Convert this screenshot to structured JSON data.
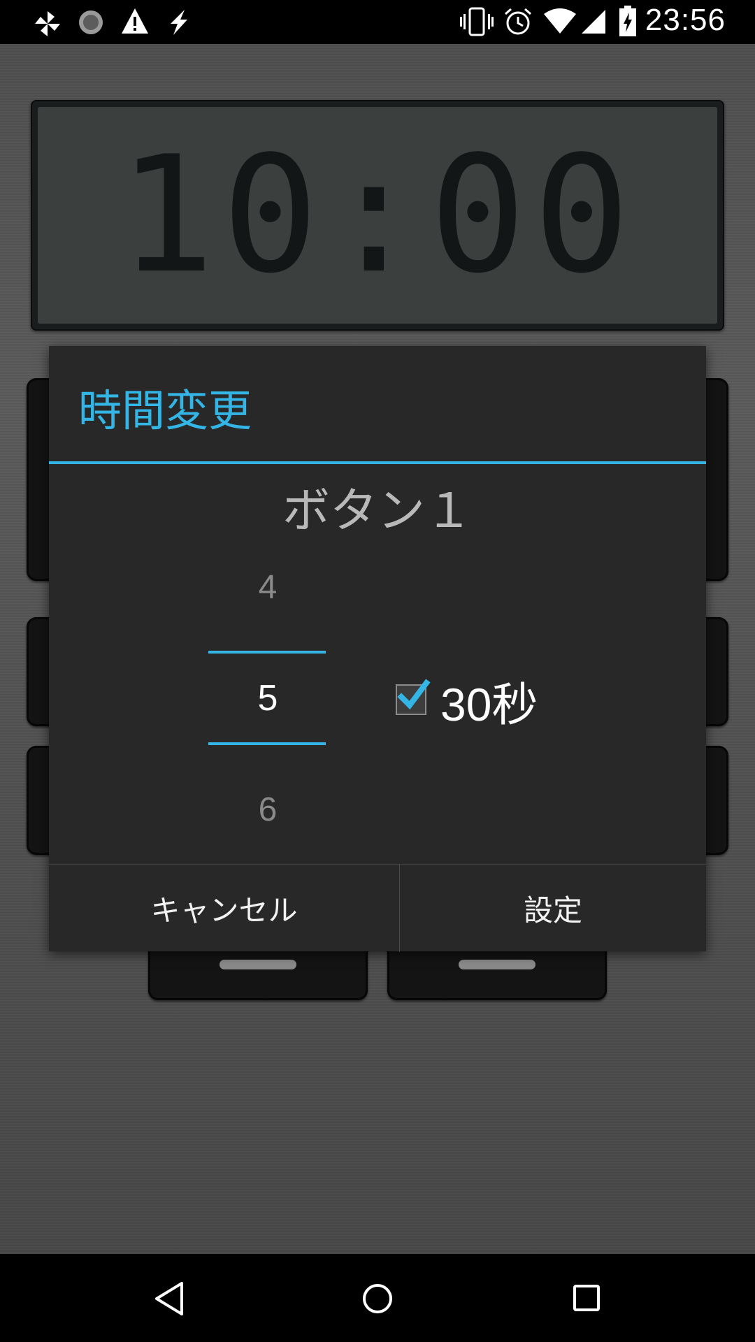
{
  "status_bar": {
    "time": "23:56",
    "icons": [
      "pinwheel-icon",
      "loading-icon",
      "warning-icon",
      "flash-icon",
      "vibrate-icon",
      "alarm-icon",
      "wifi-icon",
      "signal-icon",
      "battery-charging-icon"
    ]
  },
  "timer": {
    "display": "10:00"
  },
  "dialog": {
    "title": "時間変更",
    "label": "ボタン１",
    "picker": {
      "prev": "4",
      "selected": "5",
      "next": "6"
    },
    "checkbox": {
      "label": "30秒",
      "checked": true
    },
    "cancel_label": "キャンセル",
    "set_label": "設定"
  },
  "nav_bar": {
    "buttons": [
      "back-icon",
      "home-icon",
      "recents-icon"
    ]
  },
  "colors": {
    "accent": "#33b5e5",
    "dialog_bg": "#282828",
    "lcd_bg": "#3b3f3d"
  }
}
